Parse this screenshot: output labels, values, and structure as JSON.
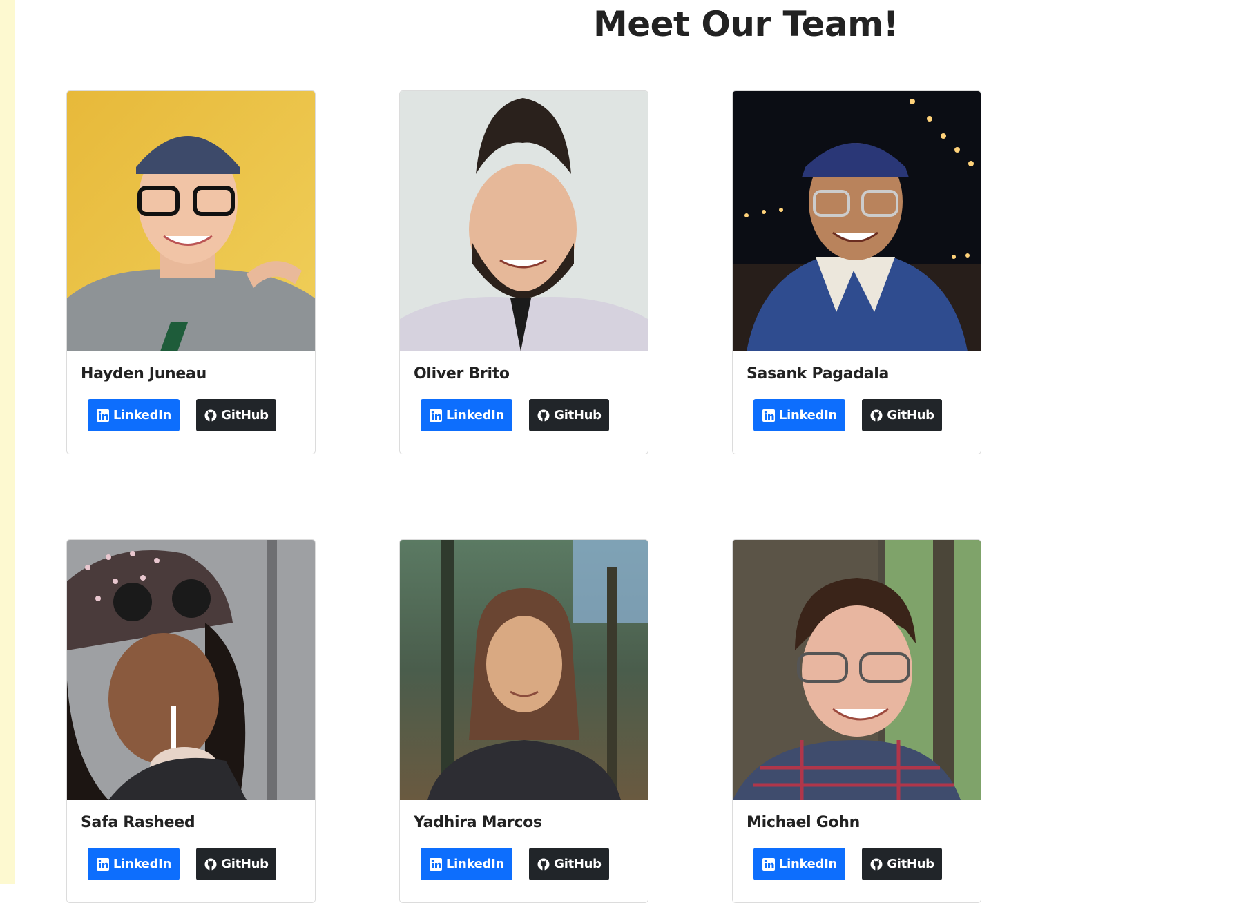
{
  "page": {
    "title": "Meet Our Team!",
    "colors": {
      "side_strip": "#fdf9d0",
      "linkedin_button": "#0d6efd",
      "github_button": "#212529"
    }
  },
  "team": {
    "members": [
      {
        "name": "Hayden Juneau",
        "linkedin_label": "LinkedIn",
        "github_label": "GitHub"
      },
      {
        "name": "Oliver Brito",
        "linkedin_label": "LinkedIn",
        "github_label": "GitHub"
      },
      {
        "name": "Sasank Pagadala",
        "linkedin_label": "LinkedIn",
        "github_label": "GitHub"
      },
      {
        "name": "Safa Rasheed",
        "linkedin_label": "LinkedIn",
        "github_label": "GitHub"
      },
      {
        "name": "Yadhira Marcos",
        "linkedin_label": "LinkedIn",
        "github_label": "GitHub"
      },
      {
        "name": "Michael Gohn",
        "linkedin_label": "LinkedIn",
        "github_label": "GitHub"
      }
    ]
  }
}
